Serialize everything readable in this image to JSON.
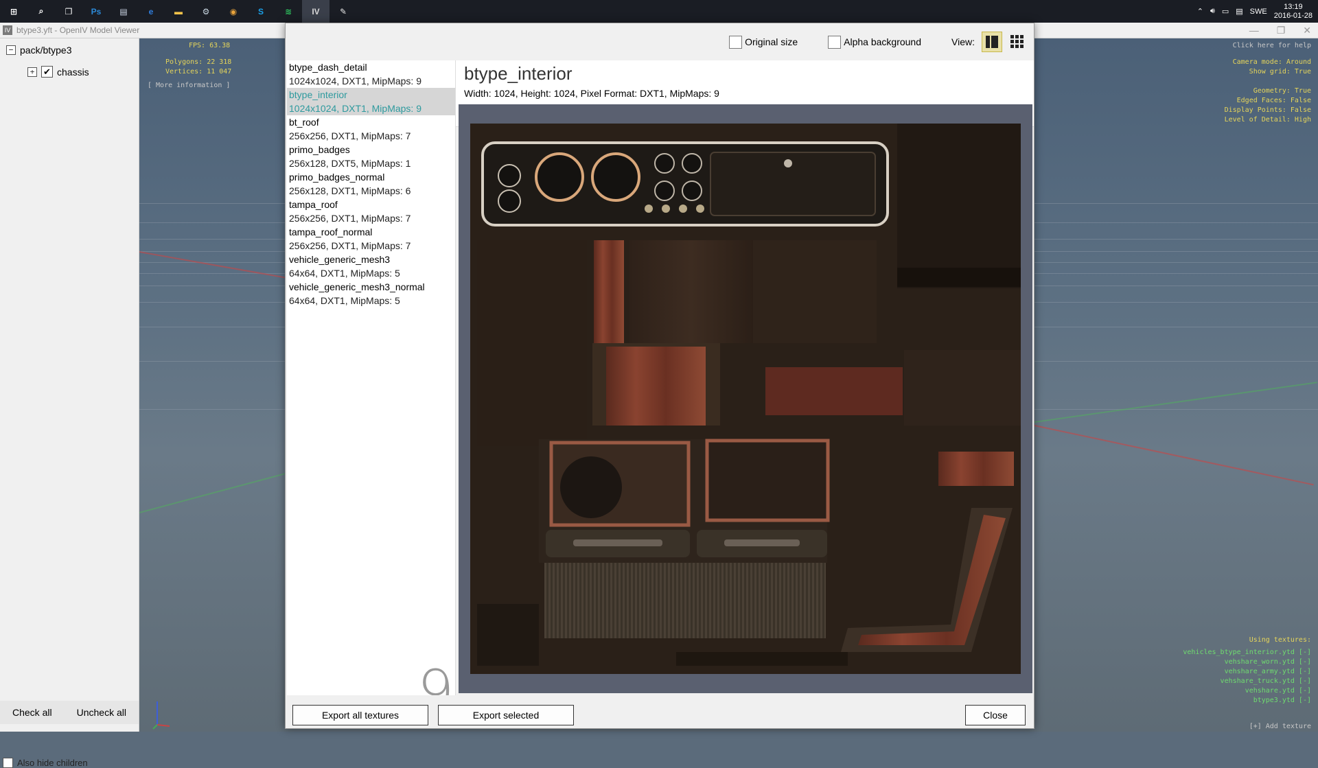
{
  "taskbar": {
    "apps": [
      {
        "icon": "windows-start-icon",
        "glyph": "⊞",
        "color": "#ffffff"
      },
      {
        "icon": "search-icon",
        "glyph": "⌕",
        "color": "#ffffff"
      },
      {
        "icon": "task-view-icon",
        "glyph": "❐",
        "color": "#ffffff"
      },
      {
        "icon": "photoshop-icon",
        "glyph": "Ps",
        "color": "#2c8ad8"
      },
      {
        "icon": "media-app-icon",
        "glyph": "▤",
        "color": "#cfd8e8"
      },
      {
        "icon": "edge-icon",
        "glyph": "e",
        "color": "#2f7fe0"
      },
      {
        "icon": "file-explorer-icon",
        "glyph": "▬",
        "color": "#f3c24a"
      },
      {
        "icon": "steam-icon",
        "glyph": "⚙",
        "color": "#c7d5e0"
      },
      {
        "icon": "chrome-icon",
        "glyph": "◉",
        "color": "#e8a33b"
      },
      {
        "icon": "skype-icon",
        "glyph": "S",
        "color": "#1aa0e8"
      },
      {
        "icon": "spotify-icon",
        "glyph": "≋",
        "color": "#2ec35f"
      },
      {
        "icon": "openiv-icon",
        "glyph": "IV",
        "color": "#d8d8d8"
      },
      {
        "icon": "paint-app-icon",
        "glyph": "✎",
        "color": "#e0e0e0"
      }
    ],
    "language": "SWE",
    "time": "13:19",
    "date": "2016-01-28"
  },
  "viewer": {
    "title": "btype3.yft - OpenIV Model Viewer"
  },
  "tree": {
    "root_label": "pack/btype3",
    "child_label": "chassis",
    "check_all": "Check all",
    "uncheck_all": "Uncheck all",
    "hide_children": "Also hide children"
  },
  "hud": {
    "fps": "FPS: 63.38",
    "polygons": "Polygons: 22 318",
    "vertices": "Vertices: 11 047",
    "more_info": "[ More information ]",
    "help": "Click here for help",
    "right_settings": "Camera mode: Around\n  Show grid: True\n\n   Geometry: True\n Edged Faces: False\nDisplay Points: False\nLevel of Detail: High",
    "using_textures_label": "Using textures:",
    "textures": [
      "vehicles_btype_interior.ytd [-]",
      "vehshare_worn.ytd [-]",
      "vehshare_army.ytd [-]",
      "vehshare_truck.ytd [-]",
      "vehshare.ytd [-]",
      "btype3.ytd [-]"
    ],
    "add_texture": "[+] Add texture"
  },
  "dialog": {
    "original_size": "Original size",
    "alpha_background": "Alpha background",
    "view_label": "View:",
    "textures": [
      {
        "name": "btype_dash_detail",
        "info": "1024x1024, DXT1, MipMaps: 9",
        "selected": false
      },
      {
        "name": "btype_interior",
        "info": "1024x1024, DXT1, MipMaps: 9",
        "selected": true
      },
      {
        "name": "bt_roof",
        "info": "256x256, DXT1, MipMaps: 7",
        "selected": false
      },
      {
        "name": "primo_badges",
        "info": "256x128, DXT5, MipMaps: 1",
        "selected": false
      },
      {
        "name": "primo_badges_normal",
        "info": "256x128, DXT1, MipMaps: 6",
        "selected": false
      },
      {
        "name": "tampa_roof",
        "info": "256x256, DXT1, MipMaps: 7",
        "selected": false
      },
      {
        "name": "tampa_roof_normal",
        "info": "256x256, DXT1, MipMaps: 7",
        "selected": false
      },
      {
        "name": "vehicle_generic_mesh3",
        "info": "64x64, DXT1, MipMaps: 5",
        "selected": false
      },
      {
        "name": "vehicle_generic_mesh3_normal",
        "info": "64x64, DXT1, MipMaps: 5",
        "selected": false
      }
    ],
    "mip_count": "9",
    "selected_title": "btype_interior",
    "selected_details": "Width: 1024, Height: 1024, Pixel Format: DXT1, MipMaps: 9",
    "export_all": "Export all textures",
    "export_selected": "Export selected",
    "close": "Close",
    "colors": {
      "selected_text": "#2e9a9e",
      "wood": "#7a3a2a",
      "dash": "#2a211a"
    }
  }
}
